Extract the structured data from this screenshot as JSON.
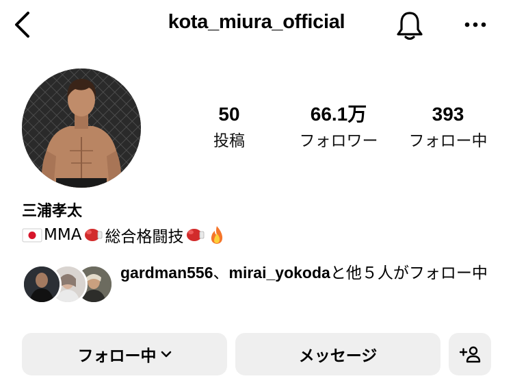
{
  "header": {
    "username": "kota_miura_official"
  },
  "stats": {
    "posts_count": "50",
    "posts_label": "投稿",
    "followers_count": "66.1万",
    "followers_label": "フォロワー",
    "following_count": "393",
    "following_label": "フォロー中"
  },
  "profile": {
    "full_name": "三浦孝太",
    "bio": {
      "mma": "MMA",
      "discipline": "総合格闘技"
    }
  },
  "mutual": {
    "user1": "gardman556",
    "separator": "、",
    "user2": "mirai_yokoda",
    "suffix": "と他５人がフォロー中"
  },
  "actions": {
    "following_label": "フォロー中",
    "message_label": "メッセージ"
  },
  "icons": [
    "back-arrow-icon",
    "bell-icon",
    "more-dots-icon",
    "japan-flag-icon",
    "boxing-glove-icon",
    "fire-icon",
    "chevron-down-icon",
    "add-person-icon"
  ]
}
